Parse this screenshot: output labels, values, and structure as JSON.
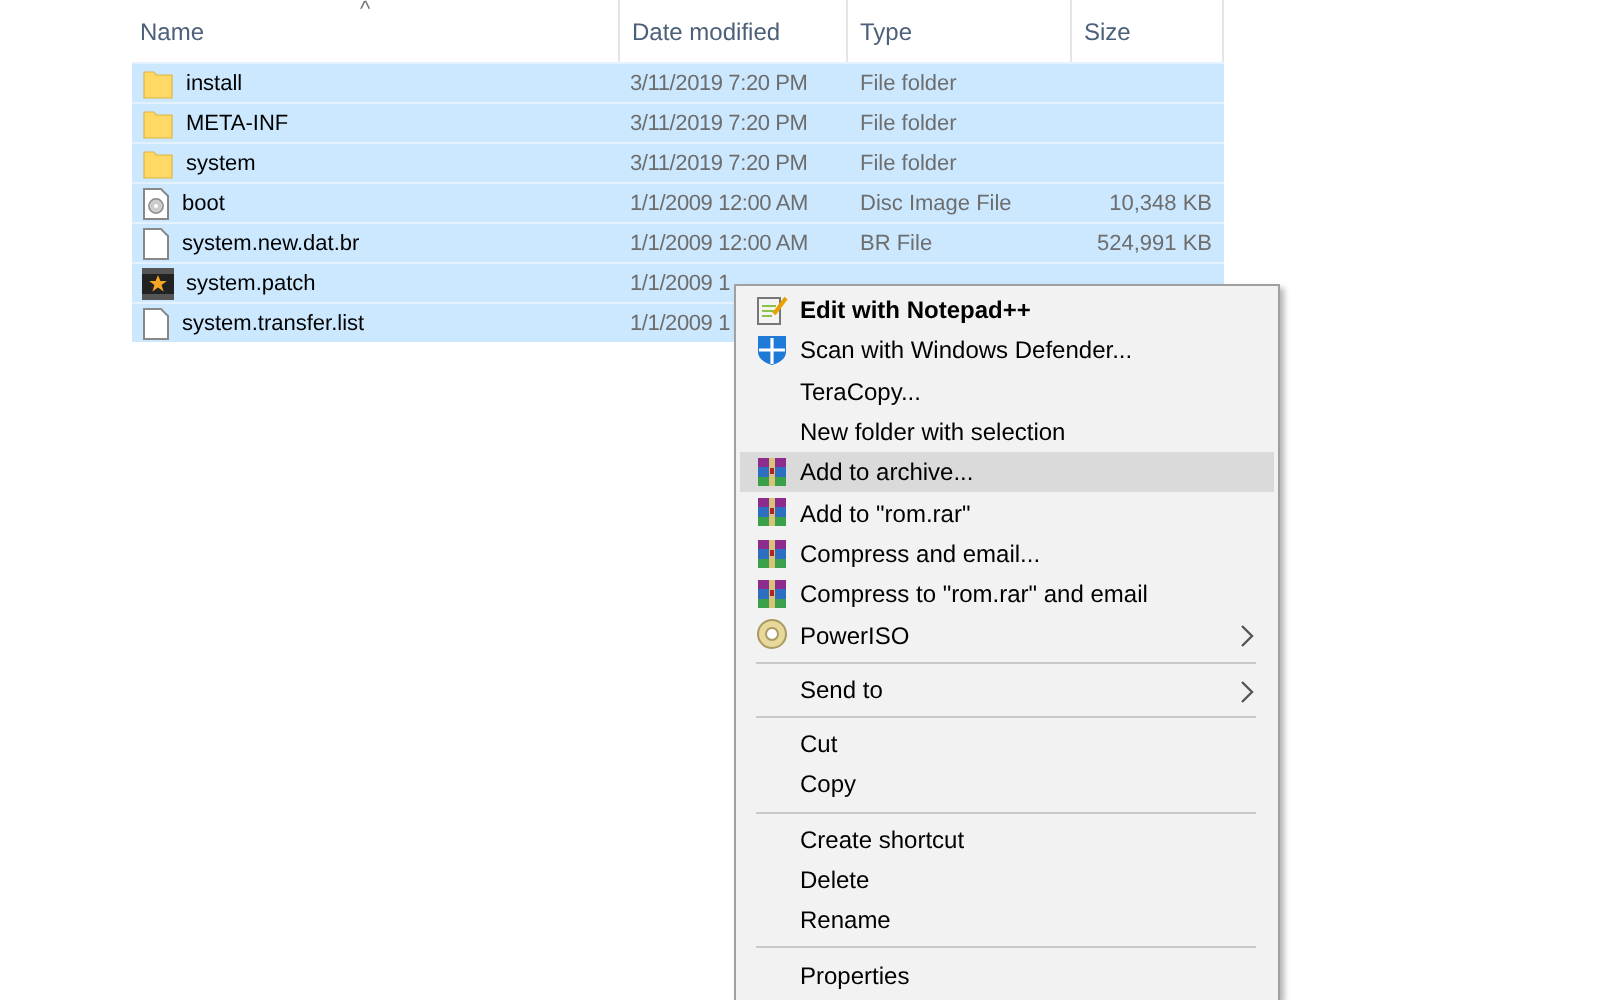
{
  "columns": [
    {
      "label": "Name",
      "sorted": true
    },
    {
      "label": "Date modified",
      "sorted": false
    },
    {
      "label": "Type",
      "sorted": false
    },
    {
      "label": "Size",
      "sorted": false
    }
  ],
  "sort_caret": "^",
  "files": [
    {
      "name": "install",
      "kind": "folder",
      "date": "3/11/2019 7:20 PM",
      "type": "File folder",
      "selected": true
    },
    {
      "name": "META-INF",
      "kind": "folder",
      "date": "3/11/2019 7:20 PM",
      "type": "File folder",
      "selected": true
    },
    {
      "name": "system",
      "kind": "folder",
      "date": "3/11/2019 7:20 PM",
      "type": "File folder",
      "selected": true
    },
    {
      "name": "boot",
      "kind": "disc-file",
      "date": "1/1/2009 12:00 AM",
      "type": "Disc Image File",
      "size": "10,348 KB",
      "selected": true
    },
    {
      "name": "system.new.dat.br",
      "kind": "file",
      "date": "1/1/2009 12:00 AM",
      "type": "BR File",
      "size": "524,991 KB",
      "selected": true
    },
    {
      "name": "system.patch",
      "kind": "media",
      "date": "1/1/2009 1",
      "selected": true
    },
    {
      "name": "system.transfer.list",
      "kind": "file",
      "date": "1/1/2009 1",
      "selected": true
    }
  ],
  "menu": [
    {
      "kind": "notepad",
      "label": "Edit with Notepad++",
      "default": true,
      "selected": false
    },
    {
      "kind": "shield",
      "label": "Scan with Windows Defender...",
      "selected": false
    },
    {
      "kind": "item",
      "label": "TeraCopy...",
      "selected": false
    },
    {
      "kind": "item",
      "label": "New folder with selection",
      "selected": false
    },
    {
      "kind": "archive",
      "label": "Add to archive...",
      "selected": true
    },
    {
      "kind": "archive",
      "label": "Add to \"rom.rar\"",
      "selected": false
    },
    {
      "kind": "archive",
      "label": "Compress and email...",
      "selected": false
    },
    {
      "kind": "archive",
      "label": "Compress to \"rom.rar\" and email",
      "selected": false
    },
    {
      "kind": "disc",
      "label": "PowerISO",
      "submenu": true,
      "selected": false
    },
    {
      "kind": "separator"
    },
    {
      "kind": "item",
      "label": "Send to",
      "submenu": true,
      "selected": false
    },
    {
      "kind": "separator"
    },
    {
      "kind": "item",
      "label": "Cut",
      "selected": false
    },
    {
      "kind": "item",
      "label": "Copy",
      "selected": false
    },
    {
      "kind": "separator"
    },
    {
      "kind": "item",
      "label": "Create shortcut",
      "selected": false
    },
    {
      "kind": "item",
      "label": "Delete",
      "selected": false
    },
    {
      "kind": "item",
      "label": "Rename",
      "selected": false
    },
    {
      "kind": "separator"
    },
    {
      "kind": "item",
      "label": "Properties",
      "selected": false
    }
  ]
}
